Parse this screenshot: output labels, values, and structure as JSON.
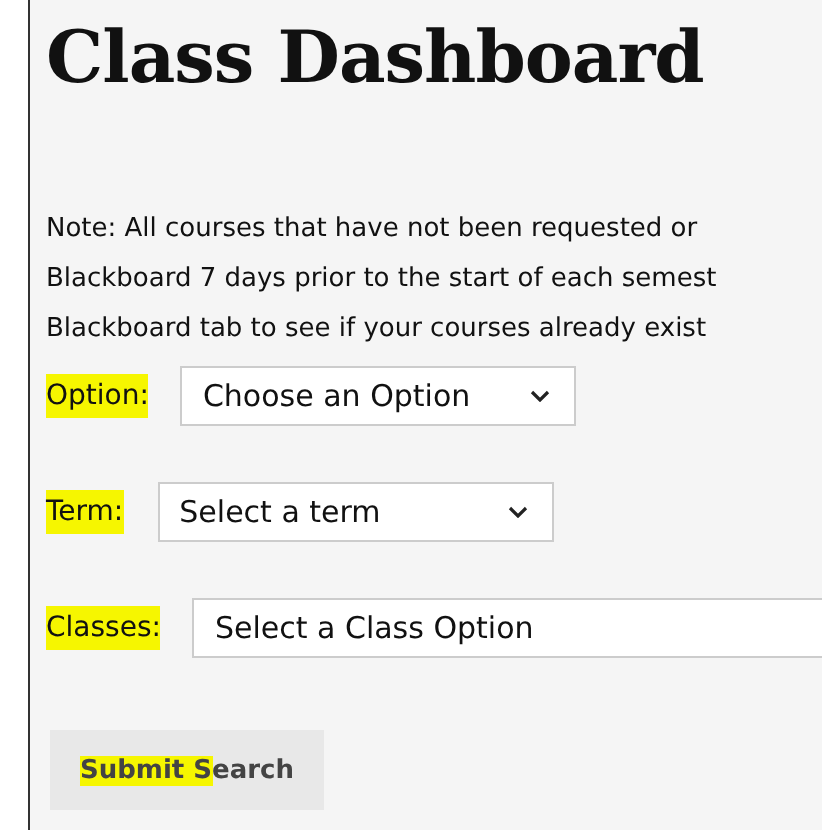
{
  "title": "Class Dashboard",
  "note_lines": [
    "Note: All courses that have not been requested or",
    "Blackboard 7 days prior to the start of each semest",
    "Blackboard tab to see if your courses already exist"
  ],
  "fields": [
    {
      "kind": "select",
      "label": "Option:",
      "label_highlighted": true,
      "value": "Choose an Option"
    },
    {
      "kind": "select",
      "label": "Term:",
      "label_highlighted": true,
      "value": "Select a term"
    },
    {
      "kind": "wide",
      "label": "Classes:",
      "label_highlighted": true,
      "value": "Select a Class Option"
    }
  ],
  "submit": {
    "label": "Submit Search",
    "highlighted": true
  }
}
